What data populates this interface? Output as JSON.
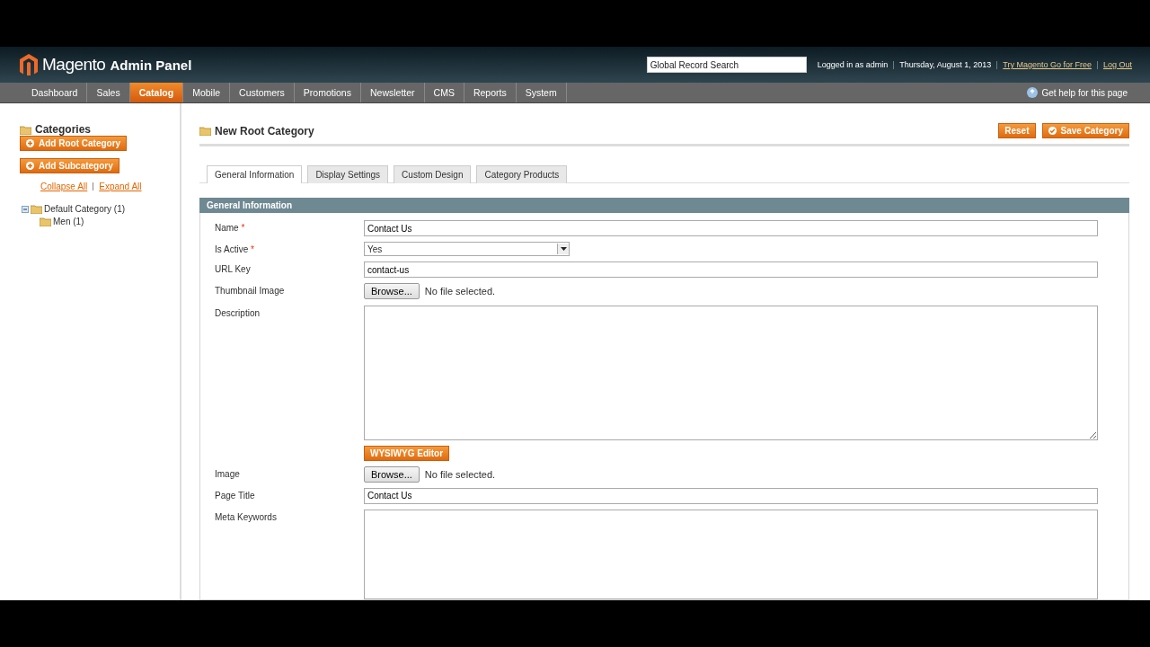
{
  "header": {
    "logo_name": "Magento",
    "logo_suffix": "Admin Panel",
    "search": {
      "placeholder": "Global Record Search"
    },
    "user_info": "Logged in as admin",
    "date": "Thursday, August 1, 2013",
    "links": [
      "Try Magento Go for Free",
      "Log Out"
    ]
  },
  "nav": {
    "items": [
      {
        "label": "Dashboard",
        "selected": false
      },
      {
        "label": "Sales",
        "selected": false
      },
      {
        "label": "Catalog",
        "selected": true
      },
      {
        "label": "Mobile",
        "selected": false
      },
      {
        "label": "Customers",
        "selected": false
      },
      {
        "label": "Promotions",
        "selected": false
      },
      {
        "label": "Newsletter",
        "selected": false
      },
      {
        "label": "CMS",
        "selected": false
      },
      {
        "label": "Reports",
        "selected": false
      },
      {
        "label": "System",
        "selected": false
      }
    ],
    "help": "Get help for this page"
  },
  "sidebar": {
    "title": "Categories",
    "buttons": [
      "Add Root Category",
      "Add Subcategory"
    ],
    "tree_links": [
      "Collapse All",
      "Expand All"
    ],
    "tree": [
      {
        "label": "Default Category (1)",
        "expanded": true,
        "children": [
          {
            "label": "Men (1)"
          }
        ]
      }
    ]
  },
  "main": {
    "title": "New Root Category",
    "actions": [
      {
        "label": "Reset",
        "kind": "plain"
      },
      {
        "label": "Save Category",
        "kind": "save"
      }
    ],
    "tabs": [
      {
        "label": "General Information",
        "selected": true
      },
      {
        "label": "Display Settings",
        "selected": false
      },
      {
        "label": "Custom Design",
        "selected": false
      },
      {
        "label": "Category Products",
        "selected": false
      }
    ],
    "section_title": "General Information",
    "fields": [
      {
        "label": "Name",
        "required_mark": "*",
        "kind": "text",
        "value": "Contact Us"
      },
      {
        "label": "Is Active",
        "required_mark": "*",
        "kind": "select",
        "value": "Yes"
      },
      {
        "label": "URL Key",
        "kind": "text",
        "value": "contact-us"
      },
      {
        "label": "Thumbnail Image",
        "kind": "file",
        "button": "Browse...",
        "status": "No file selected."
      },
      {
        "label": "Description",
        "kind": "editor",
        "button": "WYSIWYG Editor"
      },
      {
        "label": "Image",
        "kind": "file",
        "button": "Browse...",
        "status": "No file selected."
      },
      {
        "label": "Page Title",
        "kind": "text",
        "value": "Contact Us"
      },
      {
        "label": "Meta Keywords",
        "kind": "textarea"
      }
    ]
  }
}
